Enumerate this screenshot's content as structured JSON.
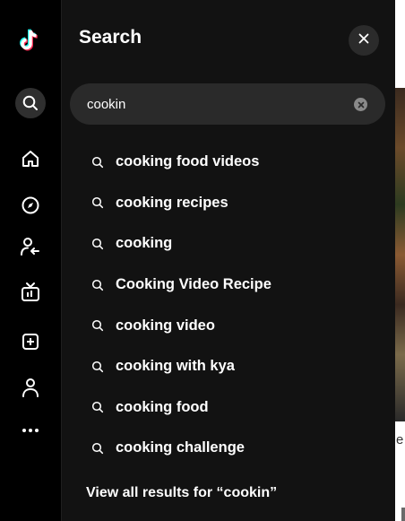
{
  "nav": {
    "items": [
      {
        "key": "logo",
        "icon": "tiktok-logo-icon"
      },
      {
        "key": "search",
        "icon": "search-icon"
      },
      {
        "key": "home",
        "icon": "home-icon"
      },
      {
        "key": "explore",
        "icon": "compass-icon"
      },
      {
        "key": "following",
        "icon": "following-icon"
      },
      {
        "key": "live",
        "icon": "live-tv-icon"
      },
      {
        "key": "upload",
        "icon": "upload-plus-icon"
      },
      {
        "key": "profile",
        "icon": "profile-icon"
      },
      {
        "key": "more",
        "icon": "more-icon"
      }
    ]
  },
  "panel": {
    "title": "Search",
    "close_icon": "close-icon",
    "clear_icon": "clear-icon"
  },
  "search": {
    "value": "cookin"
  },
  "suggestions": [
    {
      "text": "cooking food videos"
    },
    {
      "text": "cooking recipes"
    },
    {
      "text": "cooking"
    },
    {
      "text": "Cooking Video Recipe"
    },
    {
      "text": "cooking video"
    },
    {
      "text": "cooking with kya"
    },
    {
      "text": "cooking food"
    },
    {
      "text": "cooking challenge"
    }
  ],
  "view_all": "View all results for “cookin”",
  "background": {
    "edge_char": "e"
  },
  "colors": {
    "panel_bg": "#121212",
    "rail_bg": "#000000",
    "input_bg": "#2a2a2a",
    "text": "#ffffff",
    "logo_cyan": "#25f4ee",
    "logo_red": "#fe2c55"
  }
}
